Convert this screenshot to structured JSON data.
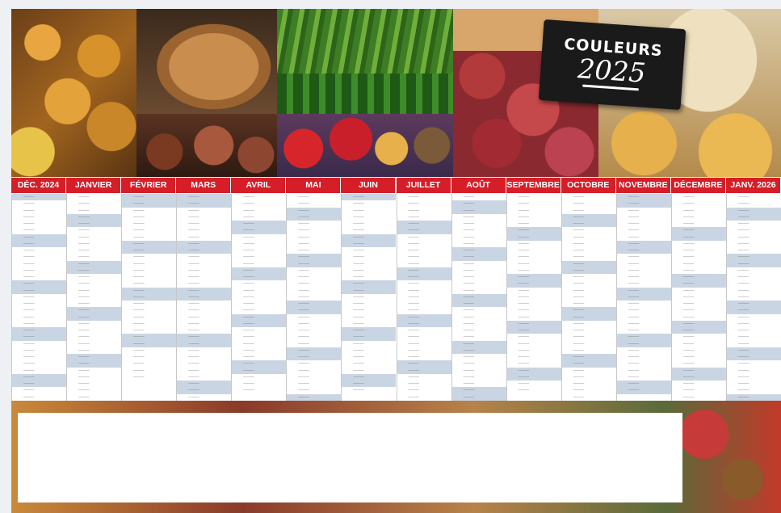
{
  "title": {
    "line1": "COULEURS",
    "line2": "2025"
  },
  "months": [
    {
      "label": "DÉC. 2024"
    },
    {
      "label": "JANVIER"
    },
    {
      "label": "FÉVRIER"
    },
    {
      "label": "MARS"
    },
    {
      "label": "AVRIL"
    },
    {
      "label": "MAI"
    },
    {
      "label": "JUIN"
    },
    {
      "label": "JUILLET"
    },
    {
      "label": "AOÛT"
    },
    {
      "label": "SEPTEMBRE"
    },
    {
      "label": "OCTOBRE"
    },
    {
      "label": "NOVEMBRE"
    },
    {
      "label": "DÉCEMBRE"
    },
    {
      "label": "JANV. 2026"
    }
  ],
  "colors": {
    "header_red": "#d51e28",
    "weekend_blue": "#c9d5e2"
  }
}
